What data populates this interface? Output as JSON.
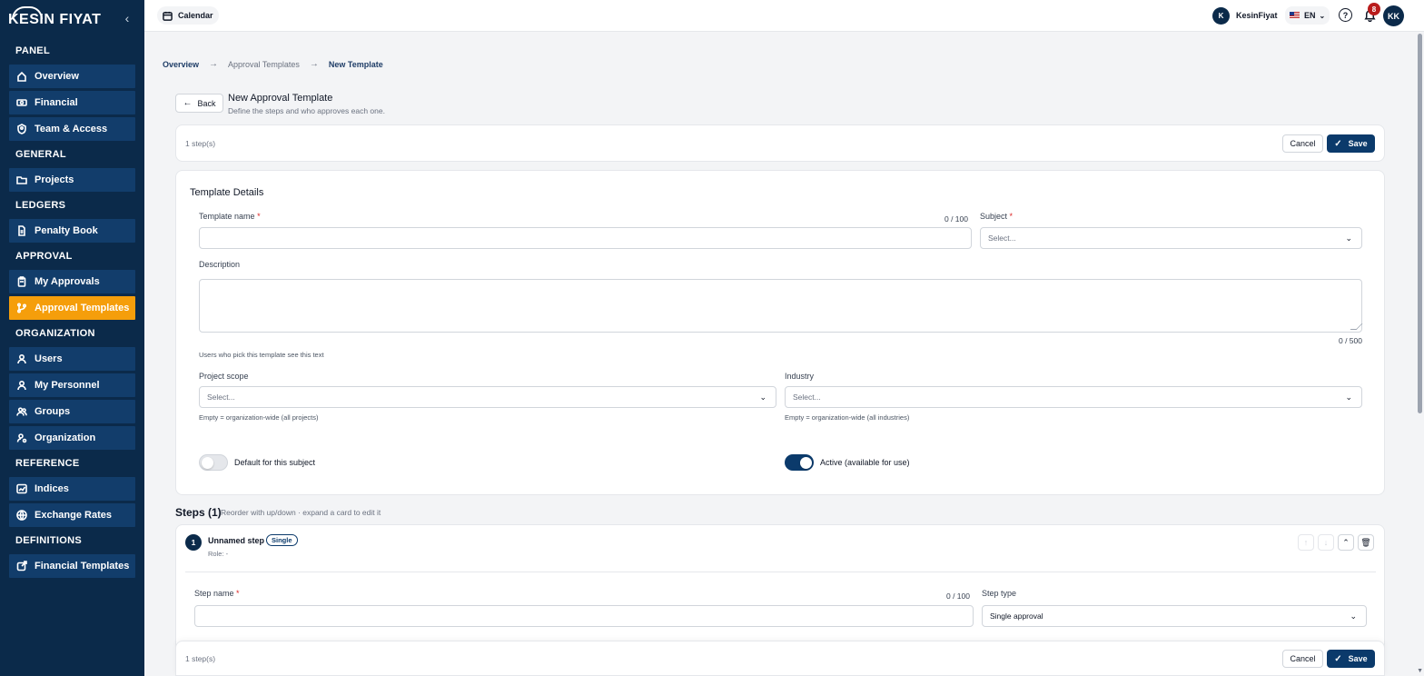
{
  "brand": {
    "name": "KESIN FIYAT"
  },
  "sidebar": {
    "sections": [
      {
        "title": "PANEL",
        "items": [
          {
            "label": "Overview",
            "icon": "home-icon"
          },
          {
            "label": "Financial",
            "icon": "money-icon"
          },
          {
            "label": "Team & Access",
            "icon": "shield-user-icon"
          }
        ]
      },
      {
        "title": "GENERAL",
        "items": [
          {
            "label": "Projects",
            "icon": "folder-icon"
          }
        ]
      },
      {
        "title": "LEDGERS",
        "items": [
          {
            "label": "Penalty Book",
            "icon": "document-icon"
          }
        ]
      },
      {
        "title": "APPROVAL",
        "items": [
          {
            "label": "My Approvals",
            "icon": "clipboard-icon"
          },
          {
            "label": "Approval Templates",
            "icon": "branch-icon",
            "active": true
          }
        ]
      },
      {
        "title": "ORGANIZATION",
        "items": [
          {
            "label": "Users",
            "icon": "user-icon"
          },
          {
            "label": "My Personnel",
            "icon": "user-icon"
          },
          {
            "label": "Groups",
            "icon": "users-icon"
          },
          {
            "label": "Organization",
            "icon": "user-cog-icon"
          }
        ]
      },
      {
        "title": "REFERENCE",
        "items": [
          {
            "label": "Indices",
            "icon": "chart-icon"
          },
          {
            "label": "Exchange Rates",
            "icon": "globe-icon"
          }
        ]
      },
      {
        "title": "DEFINITIONS",
        "items": [
          {
            "label": "Financial Templates",
            "icon": "external-icon"
          }
        ]
      }
    ]
  },
  "topbar": {
    "calendar_label": "Calendar",
    "user_initial": "K",
    "user_name": "KesinFiyat",
    "language": "EN",
    "notification_count": "8",
    "avatar_initials": "KK"
  },
  "breadcrumb": {
    "items": [
      "Overview",
      "Approval Templates",
      "New Template"
    ]
  },
  "header": {
    "back_label": "Back",
    "title": "New Approval Template",
    "subtitle": "Define the steps and who approves each one."
  },
  "action_bar": {
    "step_count": "1 step(s)",
    "cancel_label": "Cancel",
    "save_label": "Save"
  },
  "template_details": {
    "title": "Template Details",
    "name_label": "Template name",
    "name_counter": "0 / 100",
    "name_value": "",
    "subject_label": "Subject",
    "subject_placeholder": "Select...",
    "description_label": "Description",
    "description_counter": "0 / 500",
    "description_hint": "Users who pick this template see this text",
    "project_scope_label": "Project scope",
    "project_scope_placeholder": "Select...",
    "project_scope_hint": "Empty = organization-wide (all projects)",
    "industry_label": "Industry",
    "industry_placeholder": "Select...",
    "industry_hint": "Empty = organization-wide (all industries)",
    "default_label": "Default for this subject",
    "default_on": false,
    "active_label": "Active (available for use)",
    "active_on": true,
    "required_mark": "*"
  },
  "steps": {
    "heading": "Steps (1)",
    "subheading": "Reorder with up/down · expand a card to edit it",
    "items": [
      {
        "number": "1",
        "name": "Unnamed step",
        "type_badge": "Single",
        "role": "Role: -",
        "step_name_label": "Step name",
        "step_name_counter": "0 / 100",
        "step_type_label": "Step type",
        "step_type_value": "Single approval"
      }
    ]
  },
  "colors": {
    "sidebar_bg": "#0b2a4a",
    "nav_item_bg": "#123d6b",
    "active_accent": "#f59e0b",
    "primary": "#0b3a6b",
    "badge_red": "#b91c1c"
  }
}
